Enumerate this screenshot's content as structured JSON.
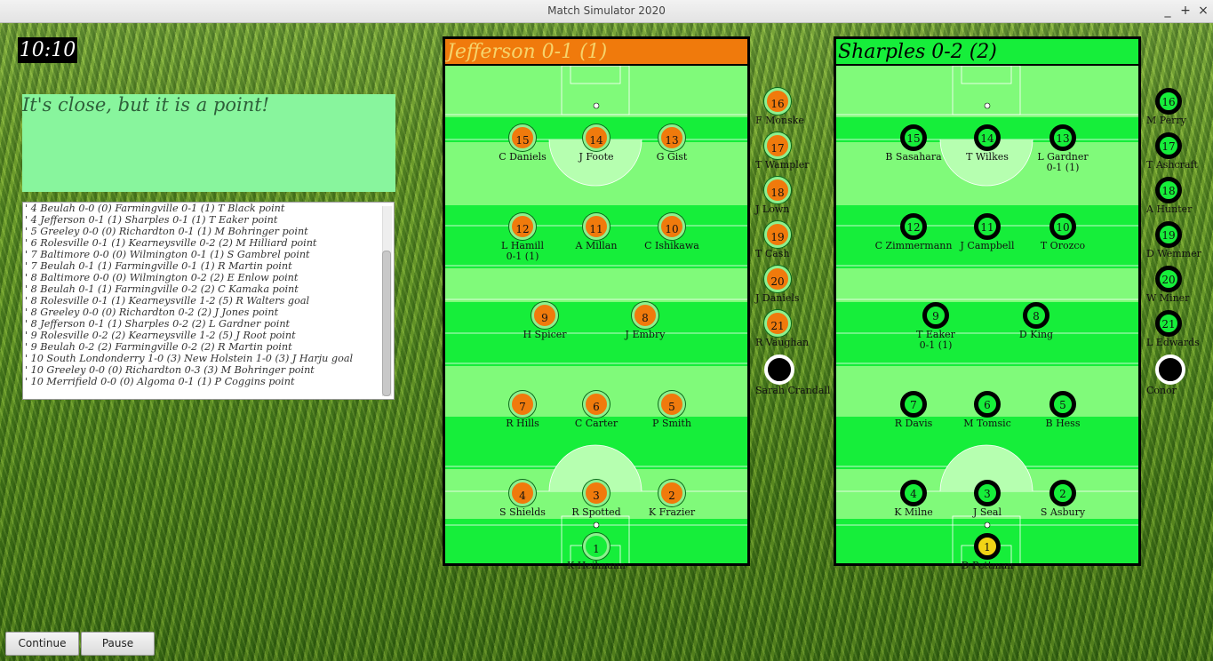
{
  "window": {
    "title": "Match Simulator 2020",
    "controls": [
      "_",
      "+",
      "×"
    ]
  },
  "clock": "10:10",
  "commentary": "It's close, but it is a point!",
  "log": [
    "4 Beulah 0-0 (0) Farmingville 0-1 (1) T Black point",
    "4 Jefferson 0-1 (1) Sharples 0-1 (1) T Eaker point",
    "5 Greeley 0-0 (0) Richardton 0-1 (1) M Bohringer point",
    "6 Rolesville 0-1 (1) Kearneysville 0-2 (2) M Hilliard point",
    "7 Baltimore 0-0 (0) Wilmington 0-1 (1) S Gambrel point",
    "7 Beulah 0-1 (1) Farmingville 0-1 (1) R Martin point",
    "8 Baltimore 0-0 (0) Wilmington 0-2 (2) E Enlow point",
    "8 Beulah 0-1 (1) Farmingville 0-2 (2) C Kamaka point",
    "8 Rolesville 0-1 (1) Kearneysville 1-2 (5) R Walters goal",
    "8 Greeley 0-0 (0) Richardton 0-2 (2) J Jones point",
    "8 Jefferson 0-1 (1) Sharples 0-2 (2) L Gardner point",
    "9 Rolesville 0-2 (2) Kearneysville 1-2 (5) J Root point",
    "9 Beulah 0-2 (2) Farmingville 0-2 (2) R Martin point",
    "10 South Londonderry 1-0 (3) New Holstein 1-0 (3) J Harju goal",
    "10 Greeley 0-0 (0) Richardton 0-3 (3) M Bohringer point",
    "10 Merrifield 0-0 (0) Algoma 0-1 (1) P Coggins point"
  ],
  "buttons": {
    "continue": "Continue",
    "pause": "Pause"
  },
  "colors": {
    "pitch_light": "#80fa7a",
    "pitch_dark": "#16ee3a",
    "jefferson": "#f07a0c",
    "sharples_ring": "#000000",
    "keeper_sharples": "#f1d416"
  },
  "teams": [
    {
      "key": "jefferson",
      "header": "Jefferson 0-1 (1)",
      "players": [
        {
          "n": "15",
          "name": "C Daniels"
        },
        {
          "n": "14",
          "name": "J Foote"
        },
        {
          "n": "13",
          "name": "G Gist"
        },
        {
          "n": "12",
          "name": "L Hamill",
          "extra": "0-1 (1)"
        },
        {
          "n": "11",
          "name": "A Millan"
        },
        {
          "n": "10",
          "name": "C Ishikawa"
        },
        {
          "n": "9",
          "name": "H Spicer"
        },
        {
          "n": "8",
          "name": "J Embry"
        },
        {
          "n": "7",
          "name": "R Hills"
        },
        {
          "n": "6",
          "name": "C Carter"
        },
        {
          "n": "5",
          "name": "P Smith"
        },
        {
          "n": "4",
          "name": "S Shields"
        },
        {
          "n": "3",
          "name": "R Spotted"
        },
        {
          "n": "2",
          "name": "K Frazier"
        },
        {
          "n": "1",
          "name": "K Heilmann"
        }
      ],
      "subs": [
        {
          "n": "16",
          "name": "F Monske"
        },
        {
          "n": "17",
          "name": "T Wampler"
        },
        {
          "n": "18",
          "name": "J Lown"
        },
        {
          "n": "19",
          "name": "T Cash"
        },
        {
          "n": "20",
          "name": "J Daniels"
        },
        {
          "n": "21",
          "name": "R Vaughan"
        },
        {
          "n": "",
          "name": "Sarah Crandall"
        }
      ]
    },
    {
      "key": "sharples",
      "header": "Sharples 0-2 (2)",
      "players": [
        {
          "n": "15",
          "name": "B Sasahara"
        },
        {
          "n": "14",
          "name": "T Wilkes"
        },
        {
          "n": "13",
          "name": "L Gardner",
          "extra": "0-1 (1)"
        },
        {
          "n": "12",
          "name": "C Zimmermann"
        },
        {
          "n": "11",
          "name": "J Campbell"
        },
        {
          "n": "10",
          "name": "T Orozco"
        },
        {
          "n": "9",
          "name": "T Eaker",
          "extra": "0-1 (1)"
        },
        {
          "n": "8",
          "name": "D King"
        },
        {
          "n": "7",
          "name": "R Davis"
        },
        {
          "n": "6",
          "name": "M Tomsic"
        },
        {
          "n": "5",
          "name": "B Hess"
        },
        {
          "n": "4",
          "name": "K Milne"
        },
        {
          "n": "3",
          "name": "J Seal"
        },
        {
          "n": "2",
          "name": "S Asbury"
        },
        {
          "n": "1",
          "name": "D Pettman"
        }
      ],
      "subs": [
        {
          "n": "16",
          "name": "M Perry"
        },
        {
          "n": "17",
          "name": "T Ashcraft"
        },
        {
          "n": "18",
          "name": "A Hunter"
        },
        {
          "n": "19",
          "name": "D Wemmer"
        },
        {
          "n": "20",
          "name": "W Miner"
        },
        {
          "n": "21",
          "name": "L Edwards"
        },
        {
          "n": "",
          "name": "Conor"
        }
      ]
    }
  ]
}
